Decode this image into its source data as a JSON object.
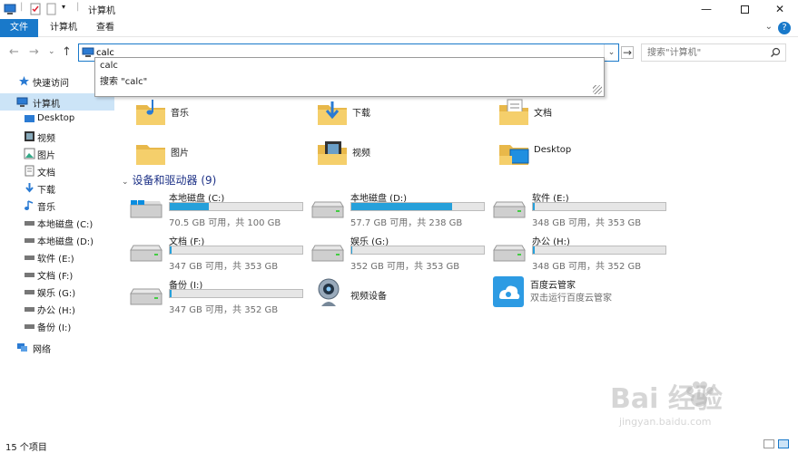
{
  "titlebar": {
    "title": "计算机"
  },
  "ribbon": {
    "tabs": [
      "文件",
      "计算机",
      "查看"
    ]
  },
  "address": {
    "value": "calc"
  },
  "search": {
    "placeholder": "搜索\"计算机\""
  },
  "autocomplete": {
    "items": [
      "calc",
      "搜索 \"calc\""
    ]
  },
  "sidebar": {
    "items": [
      {
        "label": "快速访问",
        "icon": "star-icon"
      },
      {
        "label": "计算机",
        "icon": "computer-icon",
        "selected": true
      },
      {
        "label": "Desktop",
        "icon": "desktop-icon"
      },
      {
        "label": "视频",
        "icon": "video-icon"
      },
      {
        "label": "图片",
        "icon": "picture-icon"
      },
      {
        "label": "文档",
        "icon": "document-icon"
      },
      {
        "label": "下载",
        "icon": "download-icon"
      },
      {
        "label": "音乐",
        "icon": "music-icon"
      },
      {
        "label": "本地磁盘 (C:)",
        "icon": "drive-icon"
      },
      {
        "label": "本地磁盘 (D:)",
        "icon": "drive-icon"
      },
      {
        "label": "软件 (E:)",
        "icon": "drive-icon"
      },
      {
        "label": "文档 (F:)",
        "icon": "drive-icon"
      },
      {
        "label": "娱乐 (G:)",
        "icon": "drive-icon"
      },
      {
        "label": "办公 (H:)",
        "icon": "drive-icon"
      },
      {
        "label": "备份 (I:)",
        "icon": "drive-icon"
      },
      {
        "label": "网络",
        "icon": "network-icon"
      }
    ]
  },
  "folders": [
    {
      "name": "音乐",
      "icon": "music-folder-icon"
    },
    {
      "name": "下载",
      "icon": "download-folder-icon"
    },
    {
      "name": "文档",
      "icon": "document-folder-icon"
    },
    {
      "name": "图片",
      "icon": "picture-folder-icon"
    },
    {
      "name": "视频",
      "icon": "video-folder-icon"
    },
    {
      "name": "Desktop",
      "icon": "desktop-folder-icon"
    }
  ],
  "devices_section": {
    "title": "设备和驱动器 (9)"
  },
  "drives": [
    {
      "name": "本地磁盘 (C:)",
      "info": "70.5 GB 可用，共 100 GB",
      "used_fraction": 0.295,
      "icon": "windows-drive-icon"
    },
    {
      "name": "本地磁盘 (D:)",
      "info": "57.7 GB 可用，共 238 GB",
      "used_fraction": 0.758,
      "icon": "drive-icon"
    },
    {
      "name": "软件 (E:)",
      "info": "348 GB 可用，共 353 GB",
      "used_fraction": 0.014,
      "icon": "drive-icon"
    },
    {
      "name": "文档 (F:)",
      "info": "347 GB 可用，共 353 GB",
      "used_fraction": 0.017,
      "icon": "drive-icon"
    },
    {
      "name": "娱乐 (G:)",
      "info": "352 GB 可用，共 353 GB",
      "used_fraction": 0.003,
      "icon": "drive-icon"
    },
    {
      "name": "办公 (H:)",
      "info": "348 GB 可用，共 352 GB",
      "used_fraction": 0.011,
      "icon": "drive-icon"
    },
    {
      "name": "备份 (I:)",
      "info": "347 GB 可用，共 352 GB",
      "used_fraction": 0.014,
      "icon": "drive-icon"
    }
  ],
  "webcam": {
    "name": "视频设备",
    "icon": "webcam-icon"
  },
  "baiduyun": {
    "name": "百度云管家",
    "sub": "双击运行百度云管家",
    "icon": "baiduyun-icon"
  },
  "statusbar": {
    "count": "15 个项目"
  },
  "watermark": {
    "main": "Bai  经验",
    "sub": "jingyan.baidu.com"
  },
  "colors": {
    "accent": "#1979ca",
    "bar_fill": "#26a0da",
    "selected": "#cce4f7"
  }
}
